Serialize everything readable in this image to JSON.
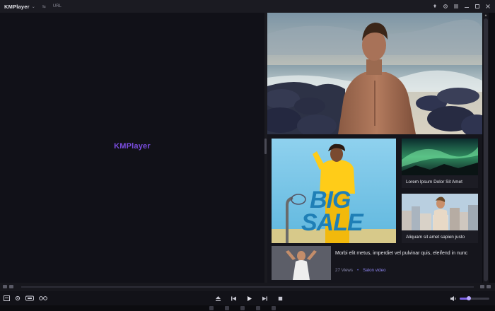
{
  "titlebar": {
    "app_name": "KMPlayer",
    "caret": "⌄",
    "sep_glyph": "⇆",
    "url_label": "URL",
    "right_icons": [
      "pin-icon",
      "settings-icon",
      "menu-icon",
      "minimize-icon",
      "restore-icon",
      "close-icon"
    ]
  },
  "player": {
    "logo_text": "KMPlayer"
  },
  "panel": {
    "cards": {
      "sale": {
        "text_line1": "BIG",
        "text_line2": "SALE"
      },
      "aurora": {
        "caption": "Lorem Ipsum Dolor Sit Amet"
      },
      "city": {
        "caption": "Aliquam sit amet sapien justo"
      }
    },
    "list_item": {
      "title": "Morbi elit metus, imperdiet vel pulvinar quis, eleifend in nunc",
      "views": "27 Views",
      "dot": "•",
      "category": "Salon video"
    }
  },
  "controls": {
    "volume_level": 0.32
  },
  "colors": {
    "accent": "#7a4de0",
    "bg": "#0d0d12",
    "panel_bg": "#15151c"
  }
}
